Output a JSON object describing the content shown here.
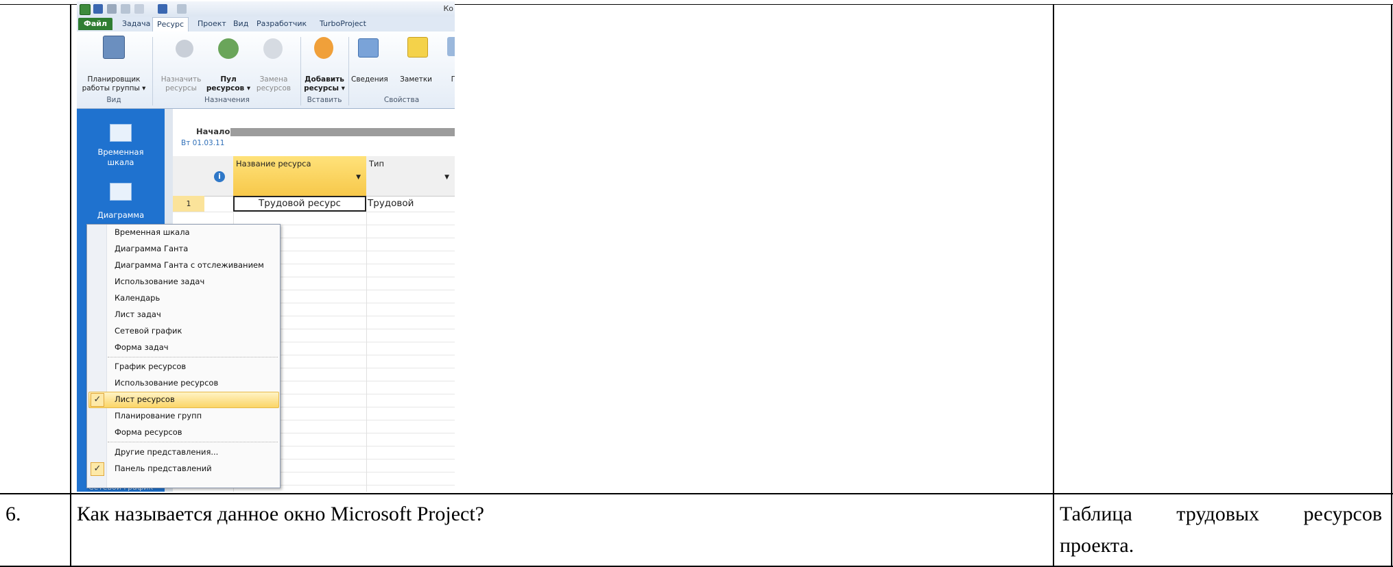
{
  "screenshot": {
    "app_title": "Ко",
    "tabs": [
      "Файл",
      "Задача",
      "Ресурс",
      "Проект",
      "Вид",
      "Разработчик",
      "TurboProject"
    ],
    "active_tab": "Ресурс",
    "ribbon": {
      "team_planner": "Планировщик\nработы группы ▾",
      "assign": "Назначить\nресурсы",
      "pool": "Пул\nресурсов ▾",
      "replace": "Замена\nресурсов",
      "add": "Добавить\nресурсы ▾",
      "info": "Сведения",
      "notes": "Заметки",
      "details": "По",
      "groups": [
        "Вид",
        "Назначения",
        "Вставить",
        "Свойства"
      ]
    },
    "view_bar": {
      "timeline": "Временная\nшкала",
      "gantt": "Диаграмма",
      "network": "Сетевой график"
    },
    "timeline": {
      "start_label": "Начало",
      "start_date": "Вт 01.03.11"
    },
    "grid": {
      "col_info": "i",
      "col_name": "Название ресурса",
      "col_type": "Тип",
      "row_num": "1",
      "row_name": "Трудовой ресурс",
      "row_type": "Трудовой"
    },
    "menu": {
      "items": [
        "Временная шкала",
        "Диаграмма Ганта",
        "Диаграмма Ганта с отслеживанием",
        "Использование задач",
        "Календарь",
        "Лист задач",
        "Сетевой график",
        "Форма задач",
        "График ресурсов",
        "Использование ресурсов",
        "Лист ресурсов",
        "Планирование групп",
        "Форма ресурсов",
        "Другие представления...",
        "Панель представлений"
      ],
      "check": "✓"
    }
  },
  "table": {
    "row_number": "6.",
    "question": "Как называется данное окно Microsoft Project?",
    "answer_line1": "Таблица трудовых ресурсов",
    "answer_line2": "проекта."
  }
}
